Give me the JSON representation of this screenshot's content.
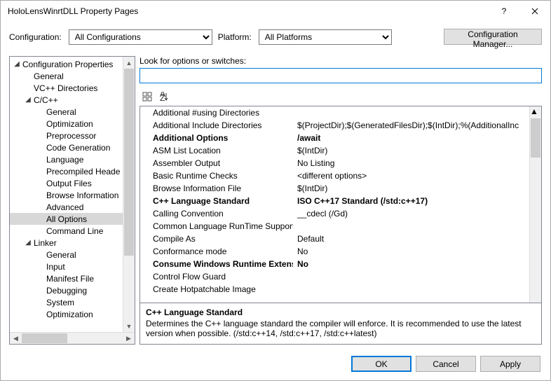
{
  "window": {
    "title": "HoloLensWinrtDLL Property Pages"
  },
  "configRow": {
    "configLabel": "Configuration:",
    "configValue": "All Configurations",
    "platformLabel": "Platform:",
    "platformValue": "All Platforms",
    "managerBtn": "Configuration Manager..."
  },
  "tree": [
    {
      "label": "Configuration Properties",
      "level": 0,
      "expanded": true
    },
    {
      "label": "General",
      "level": 1
    },
    {
      "label": "VC++ Directories",
      "level": 1
    },
    {
      "label": "C/C++",
      "level": 1,
      "expanded": true
    },
    {
      "label": "General",
      "level": 2
    },
    {
      "label": "Optimization",
      "level": 2
    },
    {
      "label": "Preprocessor",
      "level": 2
    },
    {
      "label": "Code Generation",
      "level": 2
    },
    {
      "label": "Language",
      "level": 2
    },
    {
      "label": "Precompiled Heade",
      "level": 2
    },
    {
      "label": "Output Files",
      "level": 2
    },
    {
      "label": "Browse Information",
      "level": 2
    },
    {
      "label": "Advanced",
      "level": 2
    },
    {
      "label": "All Options",
      "level": 2,
      "selected": true
    },
    {
      "label": "Command Line",
      "level": 2
    },
    {
      "label": "Linker",
      "level": 1,
      "expanded": true
    },
    {
      "label": "General",
      "level": 2
    },
    {
      "label": "Input",
      "level": 2
    },
    {
      "label": "Manifest File",
      "level": 2
    },
    {
      "label": "Debugging",
      "level": 2
    },
    {
      "label": "System",
      "level": 2
    },
    {
      "label": "Optimization",
      "level": 2
    }
  ],
  "search": {
    "label": "Look for options or switches:",
    "value": ""
  },
  "grid": [
    {
      "key": "Additional #using Directories",
      "val": ""
    },
    {
      "key": "Additional Include Directories",
      "val": "$(ProjectDir);$(GeneratedFilesDir);$(IntDir);%(AdditionalInc"
    },
    {
      "key": "Additional Options",
      "val": "/await",
      "bold": true
    },
    {
      "key": "ASM List Location",
      "val": "$(IntDir)"
    },
    {
      "key": "Assembler Output",
      "val": "No Listing"
    },
    {
      "key": "Basic Runtime Checks",
      "val": "<different options>"
    },
    {
      "key": "Browse Information File",
      "val": "$(IntDir)"
    },
    {
      "key": "C++ Language Standard",
      "val": "ISO C++17 Standard (/std:c++17)",
      "bold": true
    },
    {
      "key": "Calling Convention",
      "val": "__cdecl (/Gd)"
    },
    {
      "key": "Common Language RunTime Support",
      "val": ""
    },
    {
      "key": "Compile As",
      "val": "Default"
    },
    {
      "key": "Conformance mode",
      "val": "No"
    },
    {
      "key": "Consume Windows Runtime Extension",
      "val": "No",
      "bold": true
    },
    {
      "key": "Control Flow Guard",
      "val": ""
    },
    {
      "key": "Create Hotpatchable Image",
      "val": ""
    }
  ],
  "desc": {
    "title": "C++ Language Standard",
    "body": "Determines the C++ language standard the compiler will enforce. It is recommended to use the latest version when possible. (/std:c++14, /std:c++17, /std:c++latest)"
  },
  "footer": {
    "ok": "OK",
    "cancel": "Cancel",
    "apply": "Apply"
  }
}
